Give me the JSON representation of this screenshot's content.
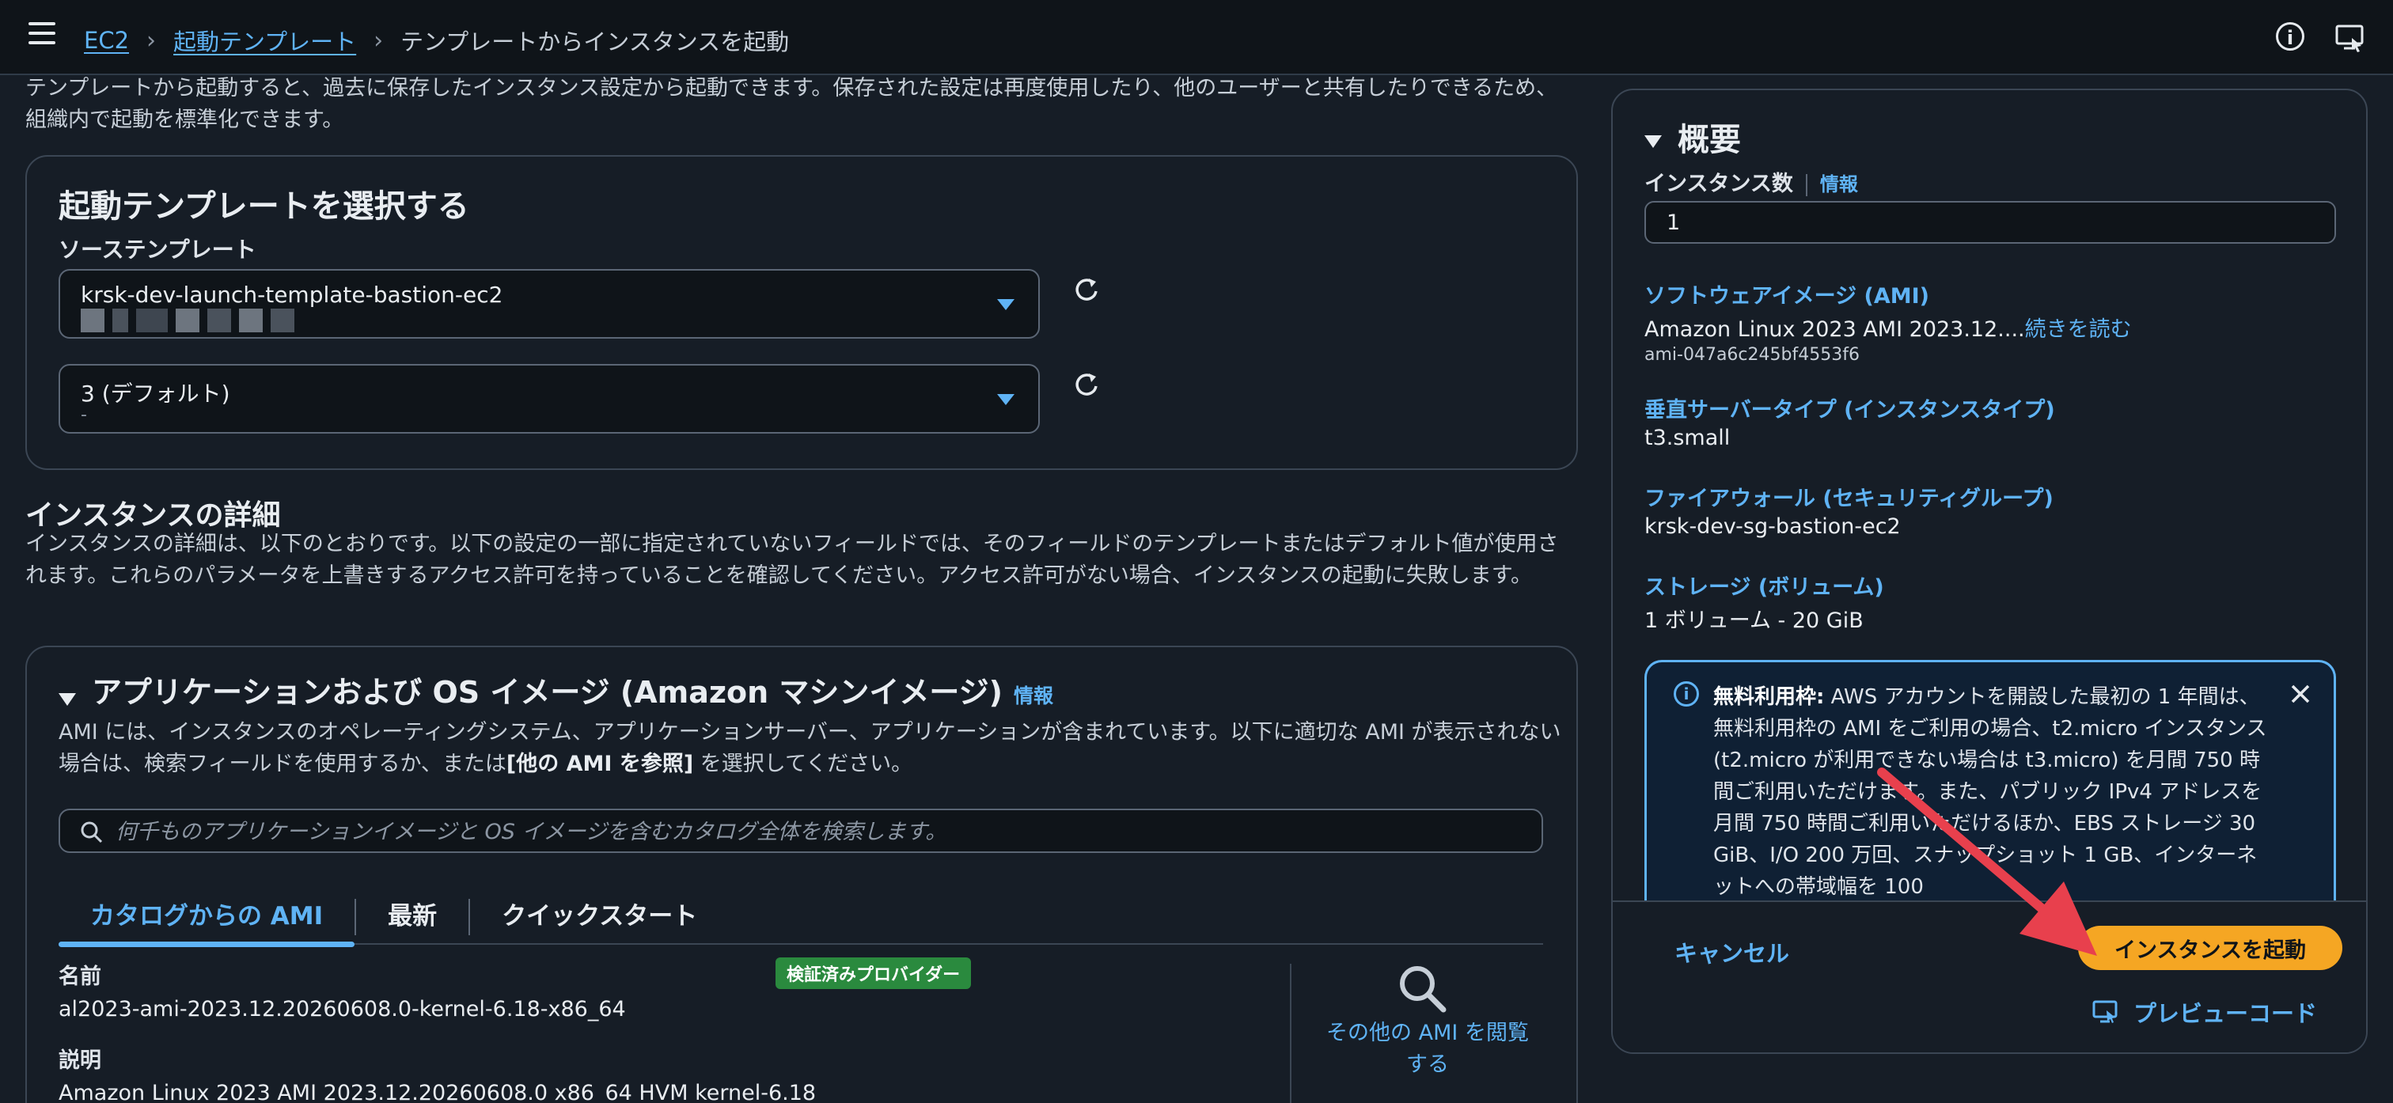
{
  "breadcrumb": {
    "items": [
      "EC2",
      "起動テンプレート"
    ],
    "current": "テンプレートからインスタンスを起動"
  },
  "intro": "テンプレートから起動すると、過去に保存したインスタンス設定から起動できます。保存された設定は再度使用したり、他のユーザーと共有したりできるため、組織内で起動を標準化できます。",
  "template_panel": {
    "title": "起動テンプレートを選択する",
    "source_label": "ソーステンプレート",
    "source_value": "krsk-dev-launch-template-bastion-ec2",
    "version_value": "3 (デフォルト)",
    "version_sub": "-"
  },
  "instance_details": {
    "title": "インスタンスの詳細",
    "description": "インスタンスの詳細は、以下のとおりです。以下の設定の一部に指定されていないフィールドでは、そのフィールドのテンプレートまたはデフォルト値が使用されます。これらのパラメータを上書きするアクセス許可を持っていることを確認してください。アクセス許可がない場合、インスタンスの起動に失敗します。"
  },
  "ami_panel": {
    "title": "アプリケーションおよび OS イメージ (Amazon マシンイメージ)",
    "info": "情報",
    "description": "AMI には、インスタンスのオペレーティングシステム、アプリケーションサーバー、アプリケーションが含まれています。以下に適切な AMI が表示されない場合は、検索フィールドを使用するか、または",
    "description_bold": "[他の AMI を参照]",
    "description_end": " を選択してください。",
    "search_placeholder": "何千ものアプリケーションイメージと OS イメージを含むカタログ全体を検索します。",
    "tabs": [
      "カタログからの AMI",
      "最新",
      "クイックスタート"
    ],
    "name_label": "名前",
    "name_value": "al2023-ami-2023.12.20260608.0-kernel-6.18-x86_64",
    "verified_badge": "検証済みプロバイダー",
    "desc_label": "説明",
    "desc_value": "Amazon Linux 2023 AMI 2023.12.20260608.0 x86_64 HVM kernel-6.18",
    "browse_more_1": "その他の AMI を閲覧",
    "browse_more_2": "する"
  },
  "summary": {
    "title": "概要",
    "count_label": "インスタンス数",
    "info": "情報",
    "count_value": "1",
    "ami_title": "ソフトウェアイメージ (AMI)",
    "ami_value": "Amazon Linux 2023 AMI 2023.12....",
    "ami_more": "続きを読む",
    "ami_id": "ami-047a6c245bf4553f6",
    "type_title": "垂直サーバータイプ (インスタンスタイプ)",
    "type_value": "t3.small",
    "firewall_title": "ファイアウォール (セキュリティグループ)",
    "firewall_value": "krsk-dev-sg-bastion-ec2",
    "storage_title": "ストレージ (ボリューム)",
    "storage_value": "1 ボリューム - 20 GiB",
    "alert_bold": "無料利用枠:",
    "alert_text": " AWS アカウントを開設した最初の 1 年間は、無料利用枠の AMI をご利用の場合、t2.micro インスタンス (t2.micro が利用できない場合は t3.micro) を月間 750 時間ご利用いただけます。また、パブリック IPv4 アドレスを月間 750 時間ご利用いただけるほか、EBS ストレージ 30 GiB、I/O 200 万回、スナップショット 1 GB、インターネットへの帯域幅を 100",
    "cancel": "キャンセル",
    "launch": "インスタンスを起動",
    "preview": "プレビューコード"
  },
  "colors": {
    "background": "#161d26",
    "link": "#5fb3f5",
    "primary_button": "#f5a623",
    "annotation_arrow": "#e8404d"
  }
}
